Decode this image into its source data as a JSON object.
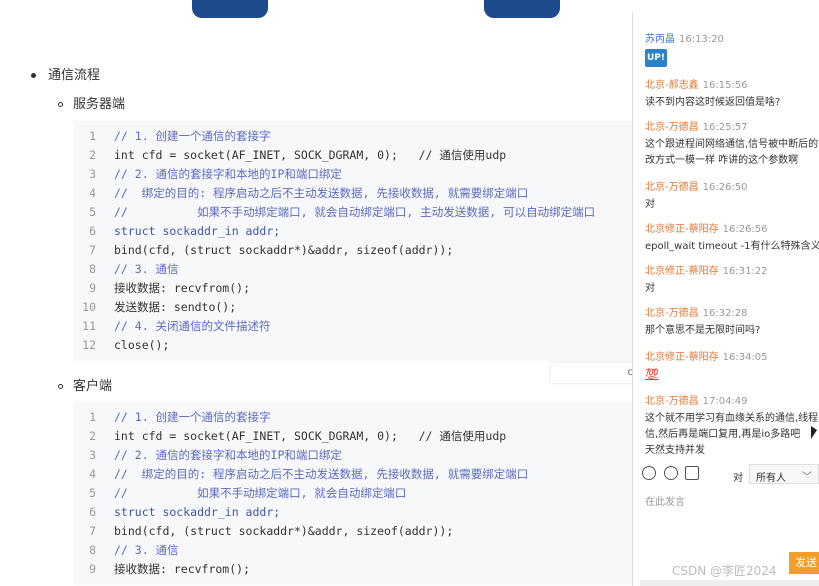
{
  "article": {
    "bullet_title": "通信流程",
    "server_title": "服务器端",
    "client_title": "客户端",
    "float_text": "c",
    "server_code": [
      {
        "n": "1",
        "t": "// 1. 创建一个通信的套接字",
        "c": "cm"
      },
      {
        "n": "2",
        "t": "int cfd = socket(AF_INET, SOCK_DGRAM, 0);   // 通信使用udp",
        "c": "tx"
      },
      {
        "n": "3",
        "t": "// 2. 通信的套接字和本地的IP和端口绑定",
        "c": "cm"
      },
      {
        "n": "4",
        "t": "//  绑定的目的: 程序启动之后不主动发送数据, 先接收数据, 就需要绑定端口",
        "c": "cm"
      },
      {
        "n": "5",
        "t": "//          如果不手动绑定端口, 就会自动绑定端口, 主动发送数据, 可以自动绑定端口",
        "c": "cm"
      },
      {
        "n": "6",
        "t": "struct sockaddr_in addr;",
        "c": "kw"
      },
      {
        "n": "7",
        "t": "bind(cfd, (struct sockaddr*)&addr, sizeof(addr));",
        "c": "tx"
      },
      {
        "n": "8",
        "t": "// 3. 通信",
        "c": "cm"
      },
      {
        "n": "9",
        "t": "接收数据: recvfrom();",
        "c": "tx"
      },
      {
        "n": "10",
        "t": "发送数据: sendto();",
        "c": "tx"
      },
      {
        "n": "11",
        "t": "// 4. 关闭通信的文件描述符",
        "c": "cm"
      },
      {
        "n": "12",
        "t": "close();",
        "c": "tx"
      }
    ],
    "client_code": [
      {
        "n": "1",
        "t": "// 1. 创建一个通信的套接字",
        "c": "cm"
      },
      {
        "n": "2",
        "t": "int cfd = socket(AF_INET, SOCK_DGRAM, 0);   // 通信使用udp",
        "c": "tx"
      },
      {
        "n": "3",
        "t": "// 2. 通信的套接字和本地的IP和端口绑定",
        "c": "cm"
      },
      {
        "n": "4",
        "t": "//  绑定的目的: 程序启动之后不主动发送数据, 先接收数据, 就需要绑定端口",
        "c": "cm"
      },
      {
        "n": "5",
        "t": "//          如果不手动绑定端口, 就会自动绑定端口",
        "c": "cm"
      },
      {
        "n": "6",
        "t": "struct sockaddr_in addr;",
        "c": "kw"
      },
      {
        "n": "7",
        "t": "bind(cfd, (struct sockaddr*)&addr, sizeof(addr));",
        "c": "tx"
      },
      {
        "n": "8",
        "t": "// 3. 通信",
        "c": "cm"
      },
      {
        "n": "9",
        "t": "接收数据: recvfrom();",
        "c": "tx"
      }
    ]
  },
  "chat": {
    "messages": [
      {
        "name": "苏丙晶",
        "time": "16:13:20",
        "body": "UP!",
        "badge": true,
        "blue": true
      },
      {
        "name": "北京-郝志鑫",
        "time": "16:15:56",
        "body": "读不到内容这时候返回值是啥?"
      },
      {
        "name": "北京-万德昌",
        "time": "16:25:57",
        "body": "这个跟进程间网络通信,信号被中断后的",
        "body2": "改方式一模一样  咋讲的这个参数啊"
      },
      {
        "name": "北京-万德昌",
        "time": "16:26:50",
        "body": "对"
      },
      {
        "name": "北京修正-蔡阳存",
        "time": "16:26:56",
        "body": "epoll_wait timeout -1有什么特殊含义"
      },
      {
        "name": "北京修正-蔡阳存",
        "time": "16:31:22",
        "body": "对"
      },
      {
        "name": "北京-万德昌",
        "time": "16:32:28",
        "body": "那个意思不是无限时间吗?"
      },
      {
        "name": "北京修正-蔡阳存",
        "time": "16:34:05",
        "body": "💯",
        "emoji": true
      },
      {
        "name": "北京-万德昌",
        "time": "17:04:49",
        "body": "这个就不用学习有血缘关系的通信,线程",
        "body2": "信,然后再是端口复用,再是io多路吧",
        "body3": "天然支持并发"
      }
    ],
    "to_label": "对",
    "recipient": "所有人",
    "input_placeholder": "在此发言",
    "send_label": "发送"
  },
  "watermark": "CSDN @李匠2024",
  "colors": {
    "name_orange": "#e47833",
    "name_blue": "#3977c8",
    "send": "#f39d2a",
    "code_bg": "#f6f8fa"
  }
}
